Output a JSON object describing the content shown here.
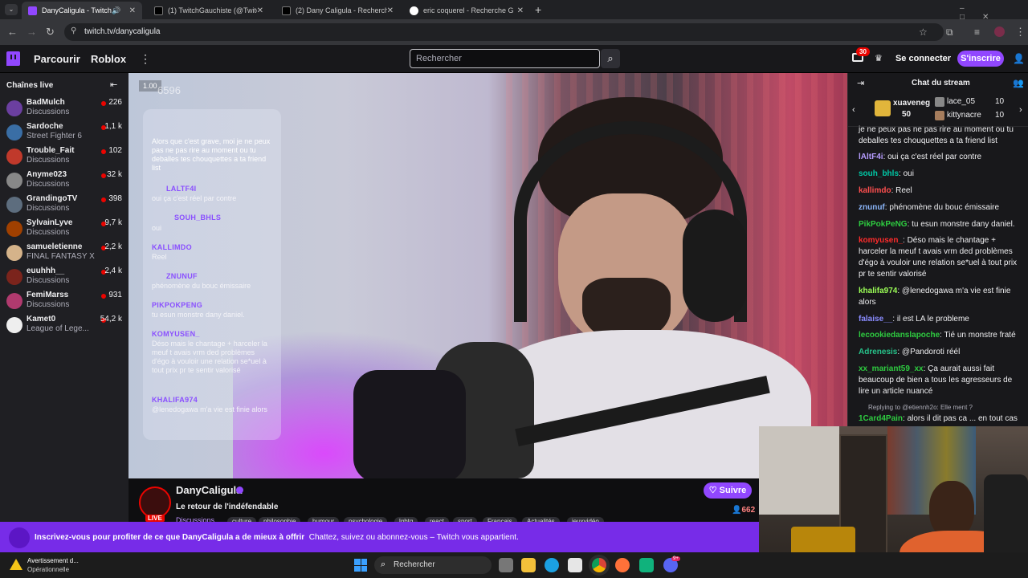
{
  "browser": {
    "tabs": [
      {
        "title": "DanyCaligula - Twitch",
        "active": true
      },
      {
        "title": "(1) TwitchGauchiste (@TwitchG"
      },
      {
        "title": "(2) Dany Caligula - Recherche /"
      },
      {
        "title": "eric coquerel - Recherche Goog"
      }
    ],
    "url": "twitch.tv/danycaligula"
  },
  "twitch": {
    "nav_browse": "Parcourir",
    "nav_roblox": "Roblox",
    "search_placeholder": "Rechercher",
    "notif_count": "30",
    "login": "Se connecter",
    "signup": "S'inscrire"
  },
  "sidebar": {
    "title": "Chaînes live",
    "channels": [
      {
        "name": "BadMulch",
        "category": "Discussions",
        "viewers": "226",
        "color": "#6b3fa0"
      },
      {
        "name": "Sardoche",
        "category": "Street Fighter 6",
        "viewers": "1,1 k",
        "color": "#3a6ea5"
      },
      {
        "name": "Trouble_Fait",
        "category": "Discussions",
        "viewers": "102",
        "color": "#c0392b"
      },
      {
        "name": "Anyme023",
        "category": "Discussions",
        "viewers": "32 k",
        "color": "#888888"
      },
      {
        "name": "GrandingoTV",
        "category": "Discussions",
        "viewers": "398",
        "color": "#5d6d7e"
      },
      {
        "name": "SylvainLyve",
        "category": "Discussions",
        "viewers": "9,7 k",
        "color": "#a04000"
      },
      {
        "name": "samueletienne",
        "category": "FINAL FANTASY X",
        "viewers": "2,2 k",
        "color": "#d5b38a"
      },
      {
        "name": "euuhhh__",
        "category": "Discussions",
        "viewers": "2,4 k",
        "color": "#7b241c"
      },
      {
        "name": "FemiMarss",
        "category": "Discussions",
        "viewers": "931",
        "color": "#b03a6e"
      },
      {
        "name": "Kamet0",
        "category": "League of Lege...",
        "viewers": "54,2 k",
        "color": "#eeeeee"
      }
    ]
  },
  "video": {
    "corner_value": "1.00",
    "overlay_number": "6596",
    "overlay_chat": [
      {
        "name": "",
        "msg": "Alors que c'est grave, moi je ne peux pas ne pas rire au moment ou tu deballes tes chouquettes a ta friend list"
      },
      {
        "name": "LALTF4I",
        "msg": "oui ça c'est réel par contre"
      },
      {
        "name": "SOUH_BHLS",
        "msg": "oui"
      },
      {
        "name": "KALLIMDO",
        "msg": "Reel"
      },
      {
        "name": "ZNUNUF",
        "msg": "phénomène du bouc émissaire"
      },
      {
        "name": "PIKPOKPENG",
        "msg": "tu esun monstre dany daniel."
      },
      {
        "name": "KOMYUSEN_",
        "msg": "Déso mais le chantage + harceler la meuf t avais vrm ded problèmes d'égo à vouloir une relation se*uel à tout prix pr te sentir valorisé"
      },
      {
        "name": "KHALIFA974",
        "msg": "@lenedogawa m'a vie est finie alors"
      }
    ]
  },
  "stream": {
    "channel": "DanyCaligula",
    "title": "Le retour de l'indéfendable",
    "live": "LIVE",
    "category": "Discussions",
    "tags": [
      "culture",
      "philosophie",
      "humour",
      "psychologie",
      "lgbtq",
      "react",
      "sport",
      "Français",
      "Actualités",
      "jeuxvidéo"
    ],
    "follow": "Suivre",
    "viewers": "662"
  },
  "chat": {
    "title": "Chat du stream",
    "gifters": [
      {
        "name": "xuaveneg",
        "count": "50"
      },
      {
        "name": "lace_05",
        "count": "10"
      },
      {
        "name": "kittynacre",
        "count": "10"
      }
    ],
    "messages": [
      {
        "user": "",
        "text": "je ne peux pas ne pas rire au moment ou tu deballes tes chouquettes a ta friend list",
        "color": "#efeff1"
      },
      {
        "user": "lAltF4i",
        "text": ": oui ça c'est réel par contre",
        "color": "#b69cff"
      },
      {
        "user": "souh_bhls",
        "text": ": oui",
        "color": "#00c9a7"
      },
      {
        "user": "kallimdo",
        "text": ": Reel",
        "color": "#ff4f4f"
      },
      {
        "user": "znunuf",
        "text": ": phénomène du bouc émissaire",
        "color": "#8ab4f8"
      },
      {
        "user": "PikPokPeNG",
        "text": ": tu esun monstre dany daniel.",
        "color": "#2ecc40"
      },
      {
        "user": "komyusen_",
        "text": ": Déso mais le chantage + harceler la meuf t avais vrm ded problèmes d'égo à vouloir une relation se*uel à tout prix pr te sentir valorisé",
        "color": "#ff2b2b"
      },
      {
        "user": "khalifa974",
        "text": ": @lenedogawa m'a vie est finie alors",
        "color": "#9cff57"
      },
      {
        "user": "falaise__",
        "text": ": il est LA le probleme",
        "color": "#8a8cff"
      },
      {
        "user": "lecookiedanslapoche",
        "text": ": Tié un monstre fraté",
        "color": "#2ecc40"
      },
      {
        "user": "Adrenesis",
        "text": ": @Pandoroti réél",
        "color": "#27c28a"
      },
      {
        "user": "xx_mariant59_xx",
        "text": ": Ça aurait aussi fait beaucoup de bien a tous les agresseurs de lire un article nuancé",
        "color": "#2ecc40"
      }
    ],
    "reply_label": "Replying to @etiennh2o: Elle ment ?",
    "reply_user": "1Card4Pain",
    "reply_text": ": alors il dit pas ca ... en tout cas"
  },
  "promo": {
    "bold": "Inscrivez-vous pour profiter de ce que DanyCaligula a de mieux à offrir",
    "rest": "Chattez, suivez ou abonnez-vous – Twitch vous appartient."
  },
  "taskbar": {
    "warn_title": "Avertissement d...",
    "warn_sub": "Opérationnelle",
    "search": "Rechercher",
    "badge": "9+"
  }
}
